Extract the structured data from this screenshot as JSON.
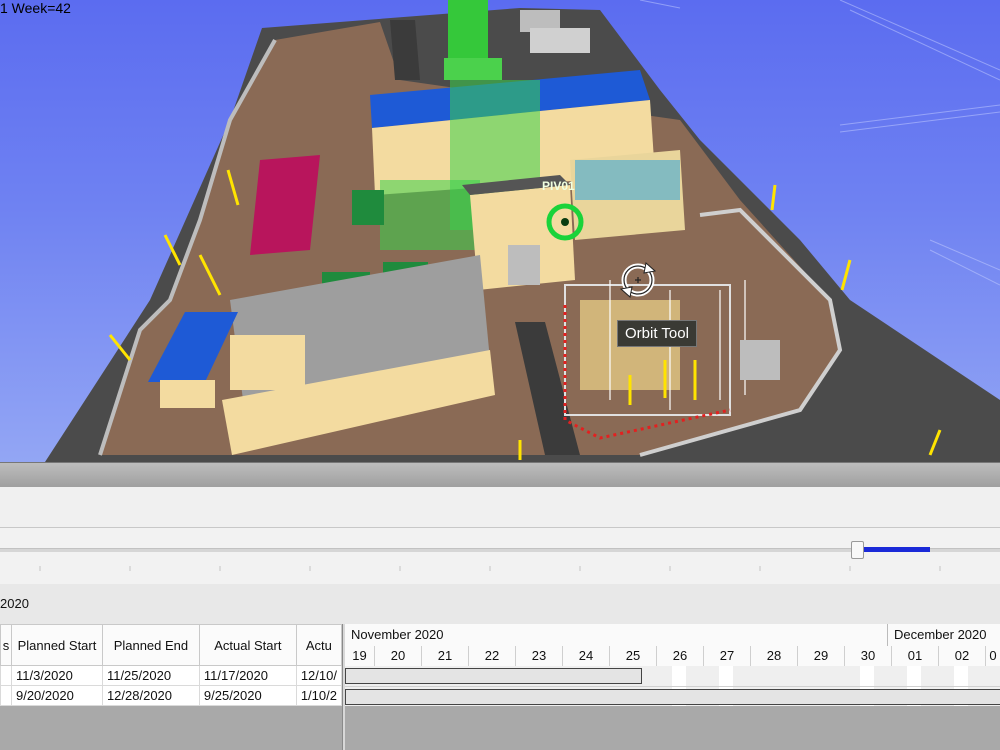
{
  "viewport": {
    "week_label": "1 Week=42",
    "tooltip": "Orbit Tool",
    "pivot_label": "PIV01",
    "cursor_icon": "orbit-cursor-icon"
  },
  "timeline": {
    "date_label": "2020"
  },
  "grid": {
    "columns": [
      "s",
      "Planned Start",
      "Planned End",
      "Actual Start",
      "Actu"
    ],
    "rows": [
      {
        "cells": [
          "",
          "11/3/2020",
          "11/25/2020",
          "11/17/2020",
          "12/10/"
        ]
      },
      {
        "cells": [
          "",
          "9/20/2020",
          "12/28/2020",
          "9/25/2020",
          "1/10/2"
        ]
      }
    ]
  },
  "gantt": {
    "months": [
      "November 2020",
      "December 2020"
    ],
    "days": [
      "19",
      "20",
      "21",
      "22",
      "23",
      "24",
      "25",
      "26",
      "27",
      "28",
      "29",
      "30",
      "01",
      "02",
      "0"
    ]
  },
  "colors": {
    "sky": "#6f82f2",
    "ground": "#8a6a55",
    "roof_blue": "#1e5ad6",
    "wall_yellow": "#f3dba0",
    "pivot_green": "#3bd14a",
    "progress": "#1b2ad8"
  }
}
